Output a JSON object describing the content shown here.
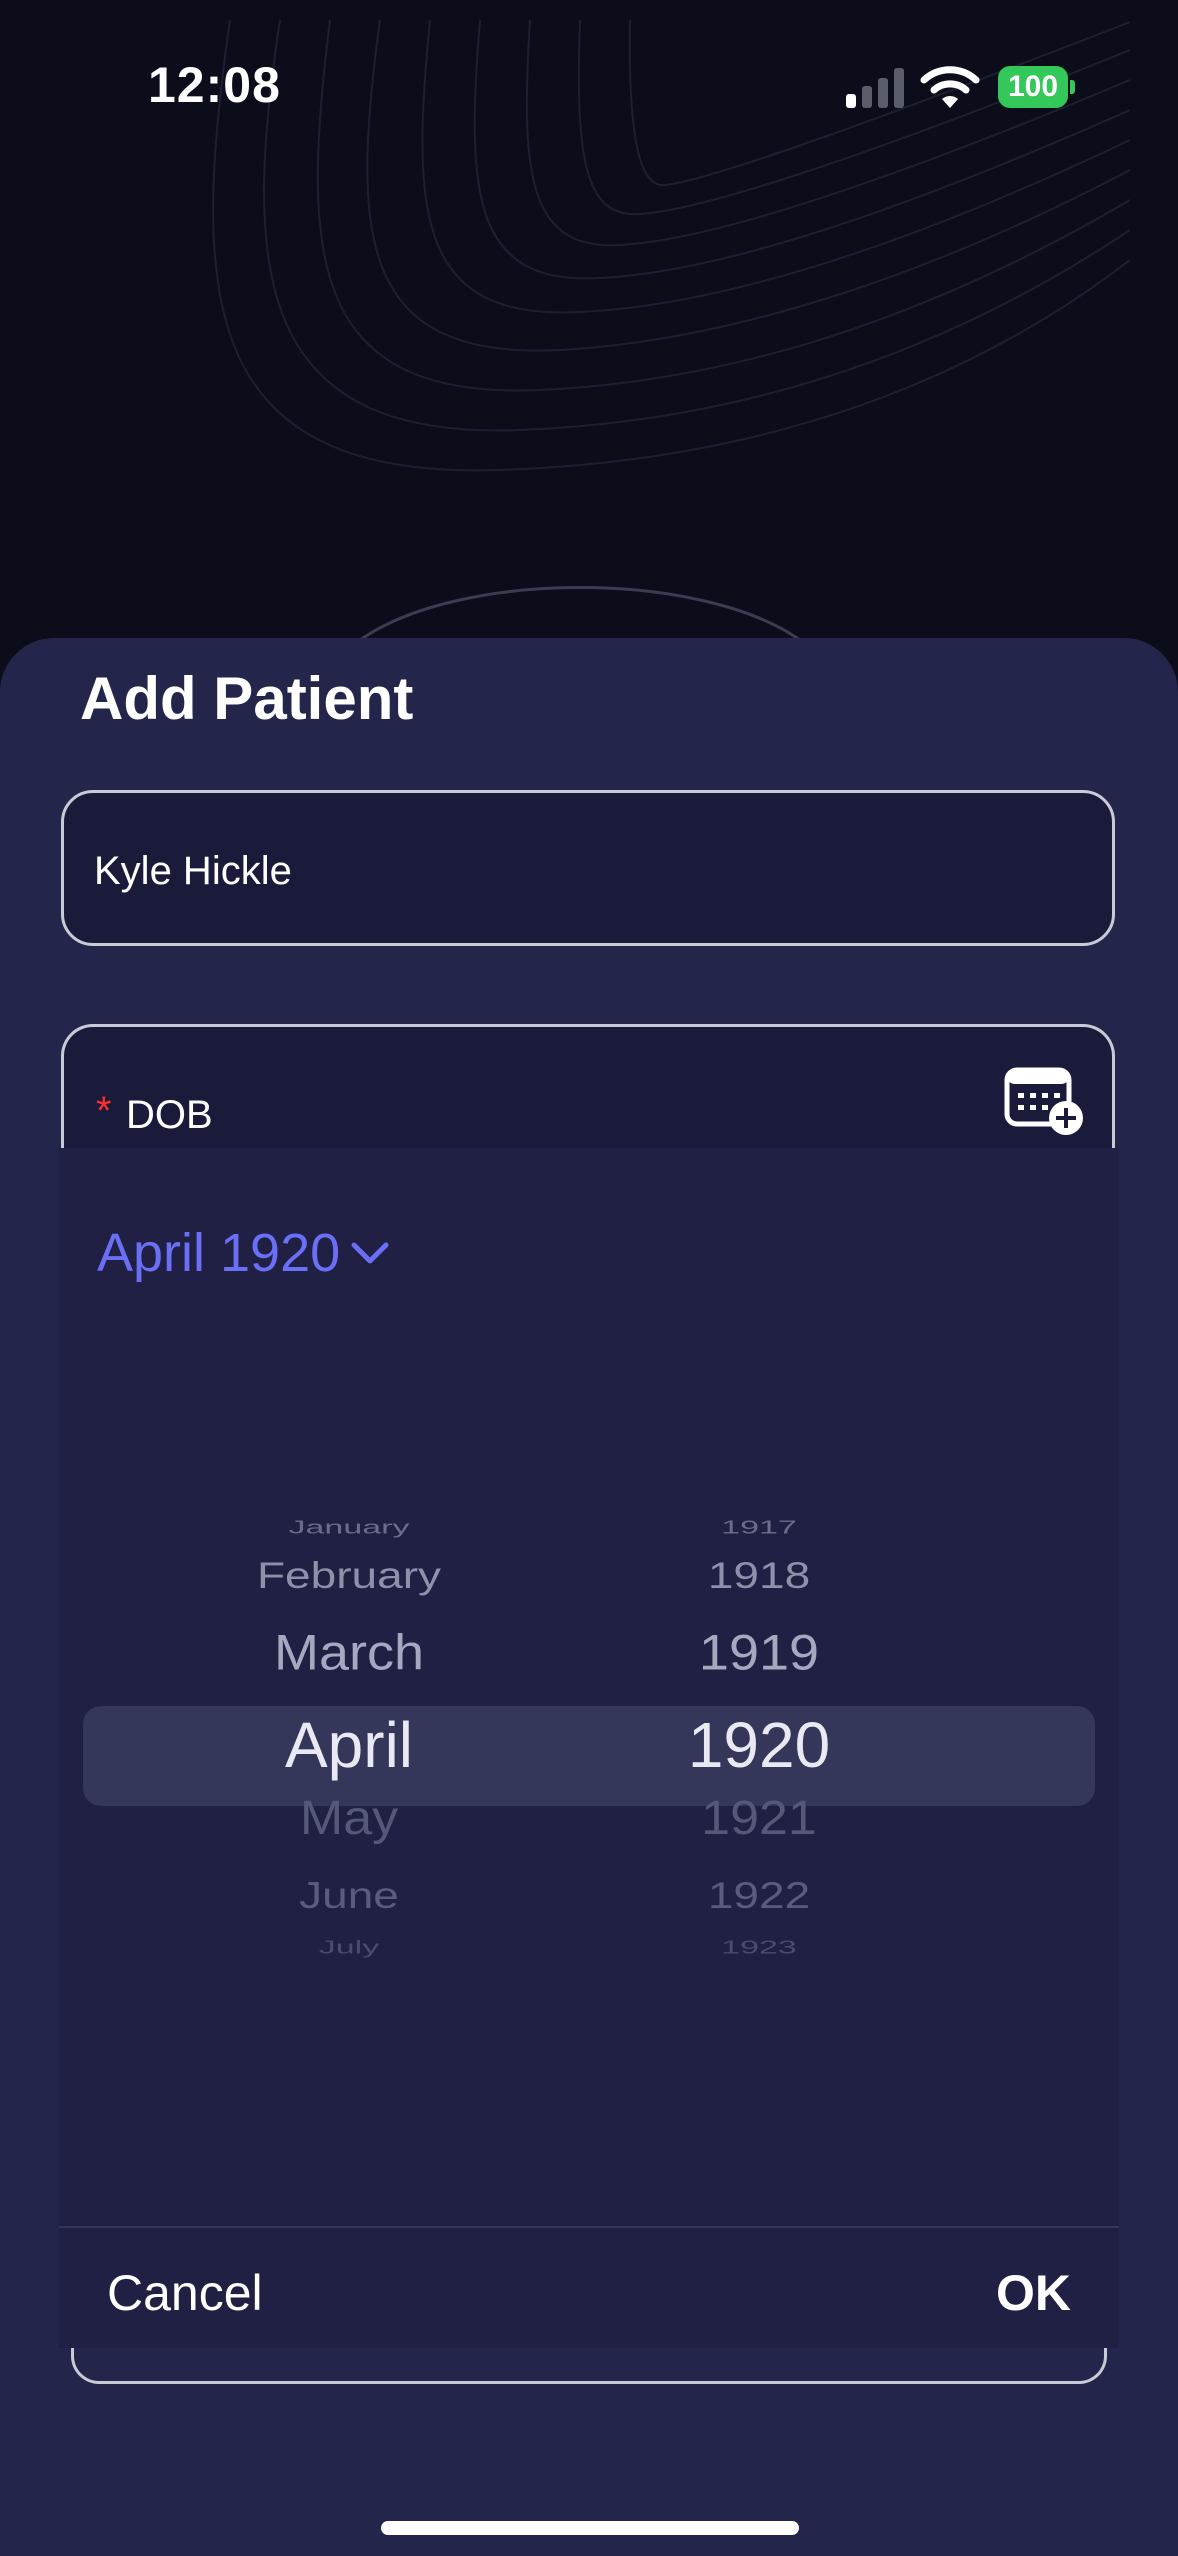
{
  "status_bar": {
    "time": "12:08",
    "battery": "100",
    "battery_color": "#34c759"
  },
  "sheet": {
    "title": "Add Patient",
    "name_field": {
      "value": "Kyle Hickle"
    },
    "dob_field": {
      "required_marker": "*",
      "label": "DOB",
      "icon": "calendar-add-icon"
    }
  },
  "date_picker": {
    "header": "April 1920",
    "header_icon": "chevron-down-icon",
    "accent_color": "#6a6ff5",
    "months": [
      "January",
      "February",
      "March",
      "April",
      "May",
      "June",
      "July"
    ],
    "years": [
      "1917",
      "1918",
      "1919",
      "1920",
      "1921",
      "1922",
      "1923"
    ],
    "selected_month": "April",
    "selected_year": "1920",
    "cancel_label": "Cancel",
    "ok_label": "OK"
  }
}
